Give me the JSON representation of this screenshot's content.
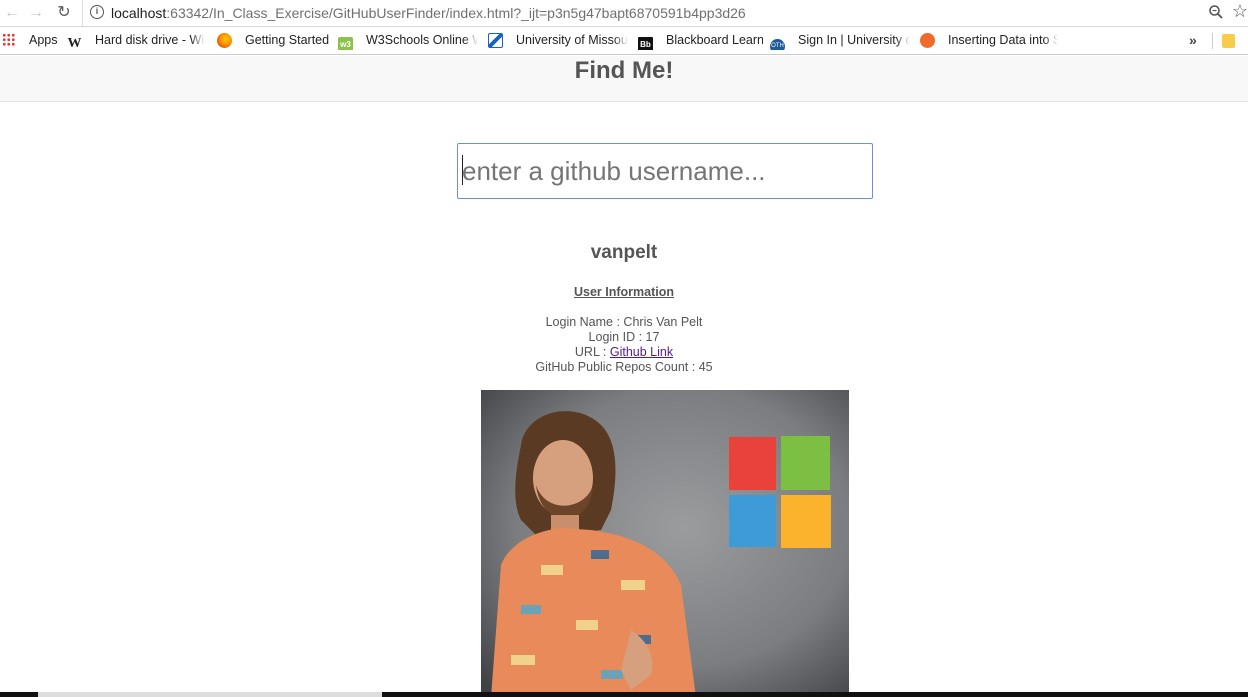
{
  "browser": {
    "url_host": "localhost",
    "url_rest": ":63342/In_Class_Exercise/GitHubUserFinder/index.html?_ijt=p3n5g47bapt6870591b4pp3d26",
    "bookmarks": [
      {
        "label": "Apps",
        "icon": "apps-grid-icon"
      },
      {
        "label": "Hard disk drive - Wi",
        "icon": "wikipedia-icon",
        "color": "#222222"
      },
      {
        "label": "Getting Started",
        "icon": "firefox-icon",
        "color": "#e66000"
      },
      {
        "label": "W3Schools Online W",
        "icon": "w3schools-icon",
        "color": "#8bc34a"
      },
      {
        "label": "University of Missou",
        "icon": "university-icon",
        "color": "#1565c0"
      },
      {
        "label": "Blackboard Learn",
        "icon": "blackboard-icon",
        "color": "#111111"
      },
      {
        "label": "Sign In | University o",
        "icon": "signin-icon",
        "color": "#1e5a9c"
      },
      {
        "label": "Inserting Data into S",
        "icon": "inserting-data-icon",
        "color": "#f06a2b"
      }
    ],
    "overflow_glyph": "»"
  },
  "page": {
    "title": "Find Me!",
    "search_placeholder": "enter a github username..."
  },
  "user": {
    "username": "vanpelt",
    "section_title": "User Information",
    "login_name_label": "Login Name : ",
    "login_name": "Chris Van Pelt",
    "login_id_label": "Login ID : ",
    "login_id": "17",
    "url_label": "URL : ",
    "url_link_text": "Github Link ",
    "repos_label": "GitHub Public Repos Count : ",
    "repos_count": "45"
  },
  "colors": {
    "heading": "#555555",
    "link_visited": "#551a8b",
    "input_border": "#6a8ee0"
  }
}
